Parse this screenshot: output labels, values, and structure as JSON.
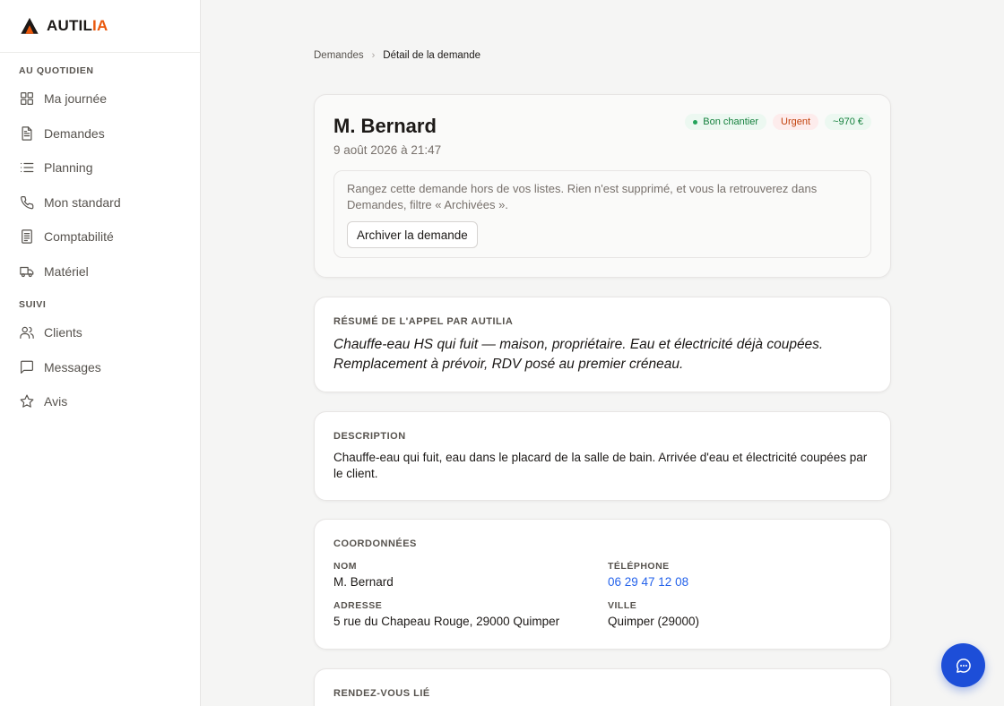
{
  "brand": {
    "name_part1": "AUTIL",
    "name_part2": "IA",
    "accent": "#ea580c"
  },
  "sidebar": {
    "section1_label": "AU QUOTIDIEN",
    "section1_items": [
      {
        "label": "Ma journée",
        "icon": "grid-icon"
      },
      {
        "label": "Demandes",
        "icon": "document-icon"
      },
      {
        "label": "Planning",
        "icon": "list-icon"
      },
      {
        "label": "Mon standard",
        "icon": "phone-icon"
      },
      {
        "label": "Comptabilité",
        "icon": "receipt-icon"
      },
      {
        "label": "Matériel",
        "icon": "truck-icon"
      }
    ],
    "section2_label": "SUIVI",
    "section2_items": [
      {
        "label": "Clients",
        "icon": "users-icon"
      },
      {
        "label": "Messages",
        "icon": "message-icon"
      },
      {
        "label": "Avis",
        "icon": "star-icon"
      }
    ]
  },
  "breadcrumb": {
    "parent": "Demandes",
    "current": "Détail de la demande"
  },
  "request": {
    "title": "M. Bernard",
    "date": "9 août 2026 à 21:47",
    "badges": {
      "good": "Bon chantier",
      "urgent": "Urgent",
      "price": "~970 €"
    },
    "archive_text": "Rangez cette demande hors de vos listes. Rien n'est supprimé, et vous la retrouverez dans Demandes, filtre « Archivées ».",
    "archive_button": "Archiver la demande"
  },
  "summary": {
    "label": "Résumé de l'appel par Autilia",
    "text": "Chauffe-eau HS qui fuit — maison, propriétaire. Eau et électricité déjà coupées. Remplacement à prévoir, RDV posé au premier créneau."
  },
  "description": {
    "label": "Description",
    "text": "Chauffe-eau qui fuit, eau dans le placard de la salle de bain. Arrivée d'eau et électricité coupées par le client."
  },
  "coordinates": {
    "label": "Coordonnées",
    "nom_label": "Nom",
    "nom": "M. Bernard",
    "tel_label": "Téléphone",
    "tel": "06 29 47 12 08",
    "adresse_label": "Adresse",
    "adresse": "5 rue du Chapeau Rouge, 29000 Quimper",
    "ville_label": "Ville",
    "ville": "Quimper (29000)"
  },
  "rdv": {
    "label": "Rendez-vous lié"
  }
}
